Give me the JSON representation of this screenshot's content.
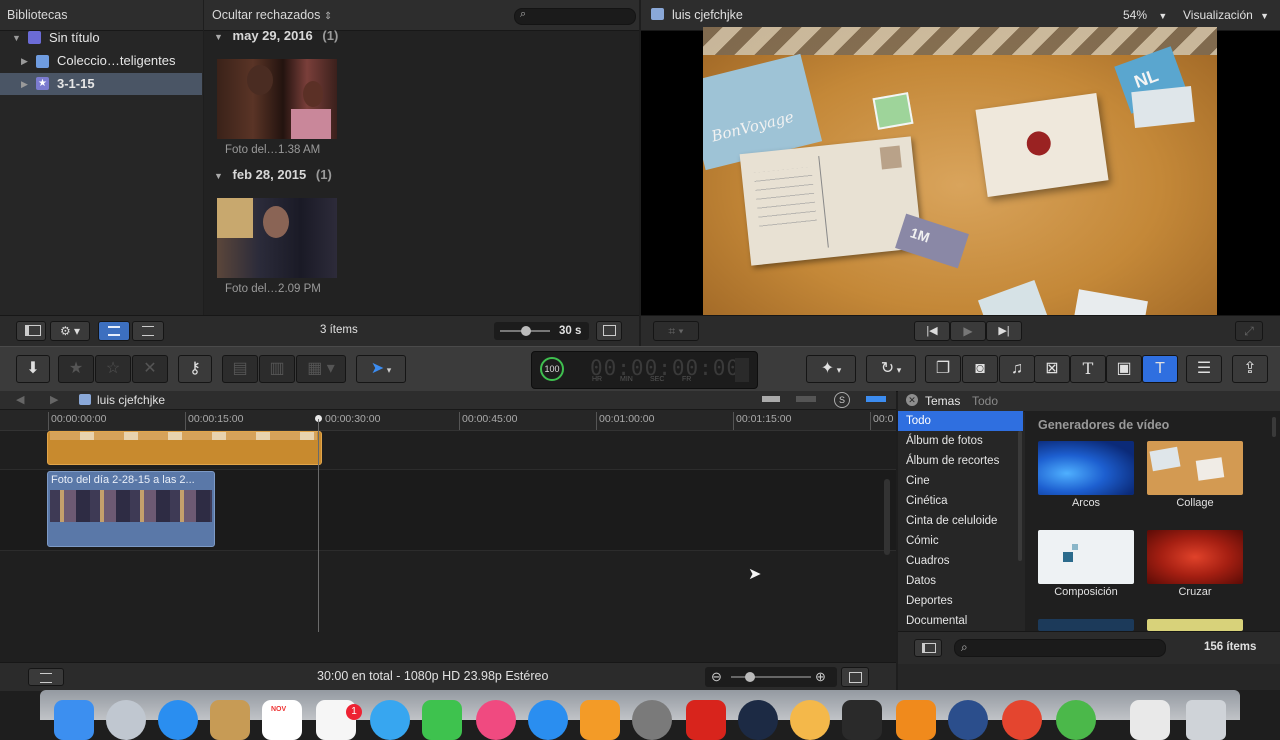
{
  "browser": {
    "libraries_header": "Bibliotecas",
    "filter_label": "Ocultar rechazados",
    "search_placeholder": "",
    "libraries": [
      {
        "label": "Sin título"
      },
      {
        "label": "Coleccio…teligentes"
      },
      {
        "label": "3-1-15"
      }
    ],
    "groups": [
      {
        "date": "may 29, 2016",
        "count": "(1)",
        "clip_label": "Foto del…1.38 AM"
      },
      {
        "date": "feb 28, 2015",
        "count": "(1)",
        "clip_label": "Foto del…2.09 PM"
      }
    ],
    "items_count": "3 ítems",
    "duration": "30 s"
  },
  "viewer": {
    "title": "luis cjefchjke",
    "zoom": "54%",
    "view_menu": "Visualización"
  },
  "toolbar": {
    "dashboard_percent": "100",
    "timecode": "00:00:00:00",
    "tc_labels": [
      "HR",
      "MIN",
      "SEC",
      "FR"
    ]
  },
  "timeline": {
    "title": "luis cjefchjke",
    "ruler": [
      "00:00:00:00",
      "00:00:15:00",
      "00:00:30:00",
      "00:00:45:00",
      "00:01:00:00",
      "00:01:15:00",
      "00:0"
    ],
    "clip_title": "Foto del día 2-28-15 a las 2...",
    "status": "30:00 en total - 1080p HD 23.98p Estéreo"
  },
  "generators": {
    "tab_themes": "Temas",
    "tab_all": "Todo",
    "categories": [
      "Todo",
      "Álbum de fotos",
      "Álbum de recortes",
      "Cine",
      "Cinética",
      "Cinta de celuloide",
      "Cómic",
      "Cuadros",
      "Datos",
      "Deportes",
      "Documental"
    ],
    "section_title": "Generadores de vídeo",
    "items": [
      {
        "label": "Arcos"
      },
      {
        "label": "Collage"
      },
      {
        "label": "Composición"
      },
      {
        "label": "Cruzar"
      }
    ],
    "items_count": "156 ítems"
  },
  "viewer_image_text": {
    "card_bonvoyage": "BonVoyage",
    "card_nl": "NL",
    "tag_1m": "1M"
  },
  "dock": {
    "calendar_month": "NOV",
    "mail_badge": "1"
  },
  "colors": {
    "selection_blue": "#3c6fbf",
    "clip_orange": "#c88a2e",
    "clip_blue": "#5a78a8",
    "accent_blue": "#2f6fe0"
  }
}
